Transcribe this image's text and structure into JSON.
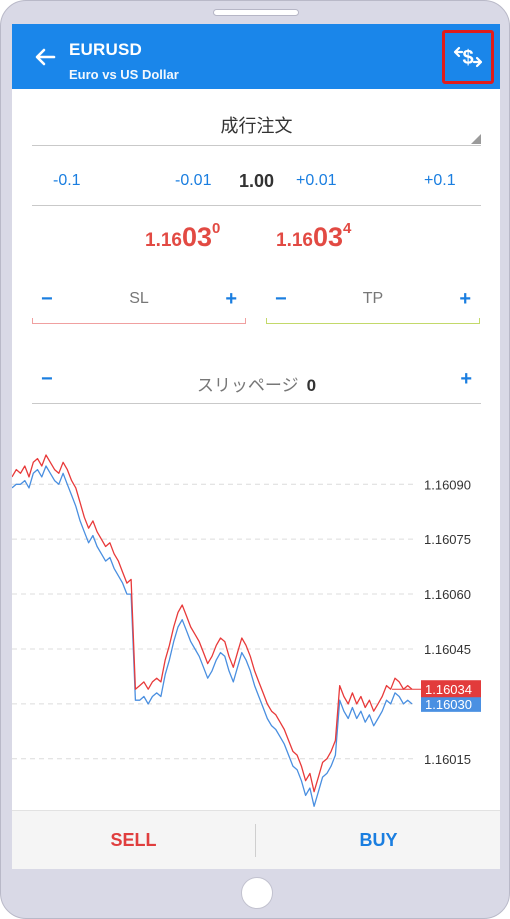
{
  "header": {
    "symbol": "EURUSD",
    "description": "Euro vs US Dollar"
  },
  "order": {
    "type_label": "成行注文"
  },
  "volume": {
    "minus_big": "-0.1",
    "minus_small": "-0.01",
    "value": "1.00",
    "plus_small": "+0.01",
    "plus_big": "+0.1"
  },
  "prices": {
    "bid": {
      "prefix": "1.16",
      "big": "03",
      "sup": "0"
    },
    "ask": {
      "prefix": "1.16",
      "big": "03",
      "sup": "4"
    }
  },
  "sl": {
    "label": "SL",
    "minus": "−",
    "plus": "+"
  },
  "tp": {
    "label": "TP",
    "minus": "−",
    "plus": "+"
  },
  "slippage": {
    "label": "スリッページ",
    "value": "0",
    "minus": "−",
    "plus": "+"
  },
  "colors": {
    "accent": "#1a86ea",
    "bid_line": "#4a8fe0",
    "ask_line": "#e83a3a",
    "sell": "#e03e3e",
    "buy": "#1a7ee0",
    "sl_line": "#f0a0a0",
    "tp_line": "#c3d96a"
  },
  "chart_data": {
    "type": "line",
    "y_ticks": [
      "1.16090",
      "1.16075",
      "1.16060",
      "1.16045",
      "1.16030",
      "1.16015"
    ],
    "y_tick_values": [
      1.1609,
      1.16075,
      1.1606,
      1.16045,
      1.1603,
      1.16015
    ],
    "ylim": [
      1.16001,
      1.16101
    ],
    "grid": "horizontal-dashed",
    "current_ask_label": "1.16034",
    "current_bid_label": "1.16030",
    "current_ask": 1.16034,
    "current_bid": 1.1603,
    "series": [
      {
        "color_key": "ask_line",
        "values": [
          1.16092,
          1.16094,
          1.16093,
          1.16095,
          1.16092,
          1.16096,
          1.16097,
          1.16095,
          1.16098,
          1.16096,
          1.16094,
          1.16093,
          1.16096,
          1.16094,
          1.16091,
          1.16089,
          1.16085,
          1.16081,
          1.16078,
          1.1608,
          1.16077,
          1.16075,
          1.16073,
          1.16074,
          1.16071,
          1.16069,
          1.16066,
          1.16063,
          1.16064,
          1.16034,
          1.16035,
          1.16036,
          1.16034,
          1.16036,
          1.16037,
          1.16036,
          1.16042,
          1.16046,
          1.16051,
          1.16055,
          1.16057,
          1.16054,
          1.16051,
          1.16049,
          1.16047,
          1.16044,
          1.16041,
          1.16043,
          1.16046,
          1.16048,
          1.16047,
          1.16043,
          1.1604,
          1.16044,
          1.16048,
          1.16046,
          1.16043,
          1.16039,
          1.16036,
          1.16033,
          1.1603,
          1.16028,
          1.16027,
          1.16025,
          1.16023,
          1.1602,
          1.16017,
          1.16016,
          1.16013,
          1.16009,
          1.16011,
          1.16006,
          1.1601,
          1.16014,
          1.16015,
          1.16017,
          1.1602,
          1.16035,
          1.16032,
          1.1603,
          1.16033,
          1.1603,
          1.16032,
          1.16029,
          1.16031,
          1.16028,
          1.1603,
          1.16032,
          1.16035,
          1.16034,
          1.16037,
          1.16036,
          1.16034,
          1.16035,
          1.16034
        ]
      },
      {
        "color_key": "bid_line",
        "values": [
          1.16089,
          1.1609,
          1.1609,
          1.16091,
          1.16089,
          1.16093,
          1.16094,
          1.16092,
          1.16095,
          1.16093,
          1.16091,
          1.1609,
          1.16093,
          1.1609,
          1.16087,
          1.16084,
          1.1608,
          1.16077,
          1.16074,
          1.16076,
          1.16073,
          1.16071,
          1.16069,
          1.1607,
          1.16067,
          1.16065,
          1.16063,
          1.1606,
          1.1606,
          1.16031,
          1.16031,
          1.16032,
          1.1603,
          1.16032,
          1.16033,
          1.16032,
          1.16038,
          1.16042,
          1.16047,
          1.16051,
          1.16053,
          1.1605,
          1.16047,
          1.16045,
          1.16043,
          1.1604,
          1.16037,
          1.16039,
          1.16042,
          1.16044,
          1.16043,
          1.16039,
          1.16036,
          1.1604,
          1.16044,
          1.16042,
          1.16039,
          1.16035,
          1.16032,
          1.16029,
          1.16026,
          1.16024,
          1.16023,
          1.16021,
          1.16019,
          1.16016,
          1.16013,
          1.16012,
          1.16009,
          1.16005,
          1.16007,
          1.16002,
          1.16006,
          1.1601,
          1.16011,
          1.16013,
          1.16016,
          1.16031,
          1.16028,
          1.16026,
          1.16029,
          1.16026,
          1.16028,
          1.16025,
          1.16027,
          1.16024,
          1.16026,
          1.16028,
          1.16031,
          1.1603,
          1.16033,
          1.16032,
          1.1603,
          1.16031,
          1.1603
        ]
      }
    ]
  },
  "footer": {
    "sell": "SELL",
    "buy": "BUY"
  }
}
